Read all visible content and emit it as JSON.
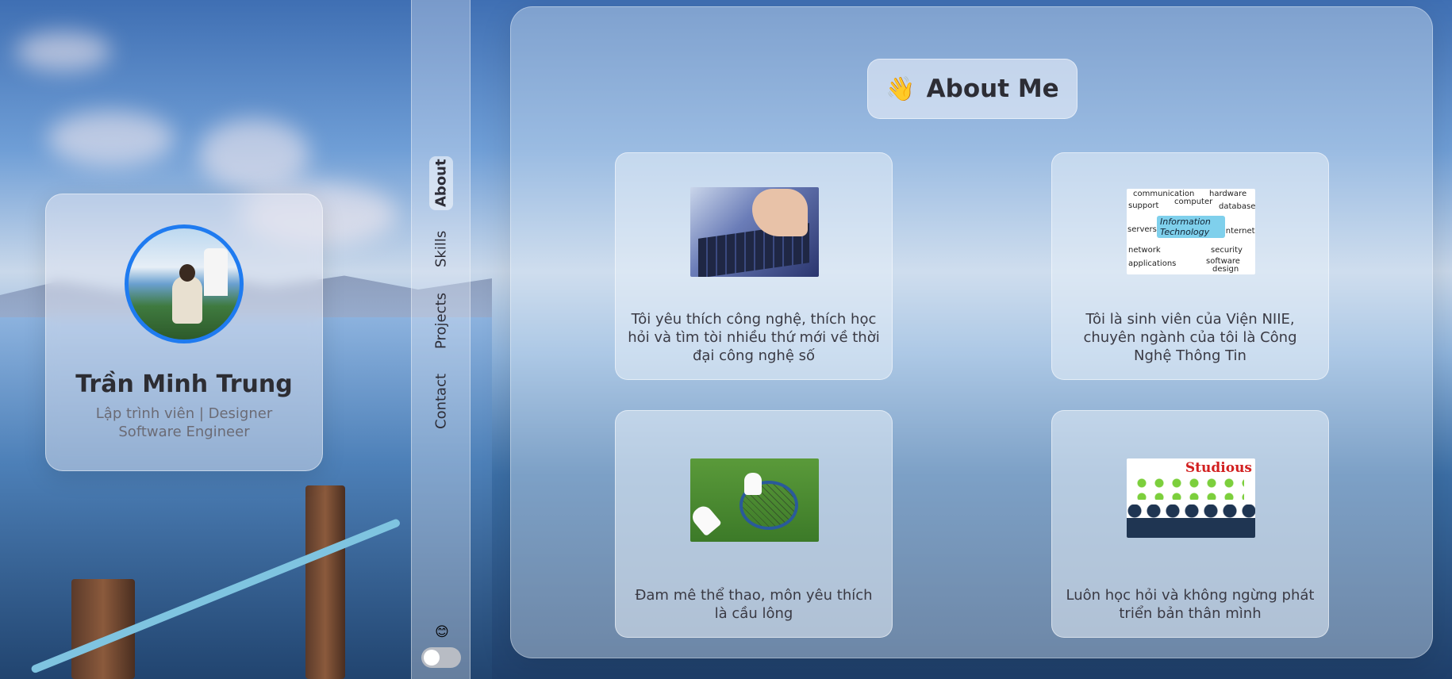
{
  "profile": {
    "name": "Trần Minh Trung",
    "role_line1": "Lập trình viên | Designer",
    "role_line2": "Software Engineer"
  },
  "nav": {
    "items": [
      {
        "label": "About",
        "active": true
      },
      {
        "label": "Skills",
        "active": false
      },
      {
        "label": "Projects",
        "active": false
      },
      {
        "label": "Contact",
        "active": false
      }
    ],
    "theme_emoji": "😊",
    "theme_toggle_on": false
  },
  "main": {
    "title_icon": "👋",
    "title": "About Me",
    "cards": [
      {
        "image_icon": "keyboard-hand-image",
        "text": "Tôi yêu thích công nghệ, thích học hỏi và tìm tòi nhiều thứ mới về thời đại công nghệ số"
      },
      {
        "image_icon": "information-technology-diagram-image",
        "text": "Tôi là sinh viên của Viện NIIE, chuyên ngành của tôi là Công Nghệ Thông Tin"
      },
      {
        "image_icon": "badminton-image",
        "text": "Đam mê thể thao, môn yêu thích là cầu lông"
      },
      {
        "image_icon": "studious-image",
        "text": "Luôn học hỏi và không ngừng phát triển bản thân mình"
      }
    ],
    "it_diagram": {
      "words": [
        "communication",
        "hardware",
        "support",
        "computer",
        "database",
        "servers",
        "internet",
        "network",
        "security",
        "applications",
        "software",
        "design"
      ],
      "banner_line1": "Information",
      "banner_line2": "Technology"
    },
    "studious_word": "Studious"
  },
  "colors": {
    "avatar_border": "#1f7bf0",
    "name_text": "#2d2d33",
    "studious_red": "#d22020"
  }
}
